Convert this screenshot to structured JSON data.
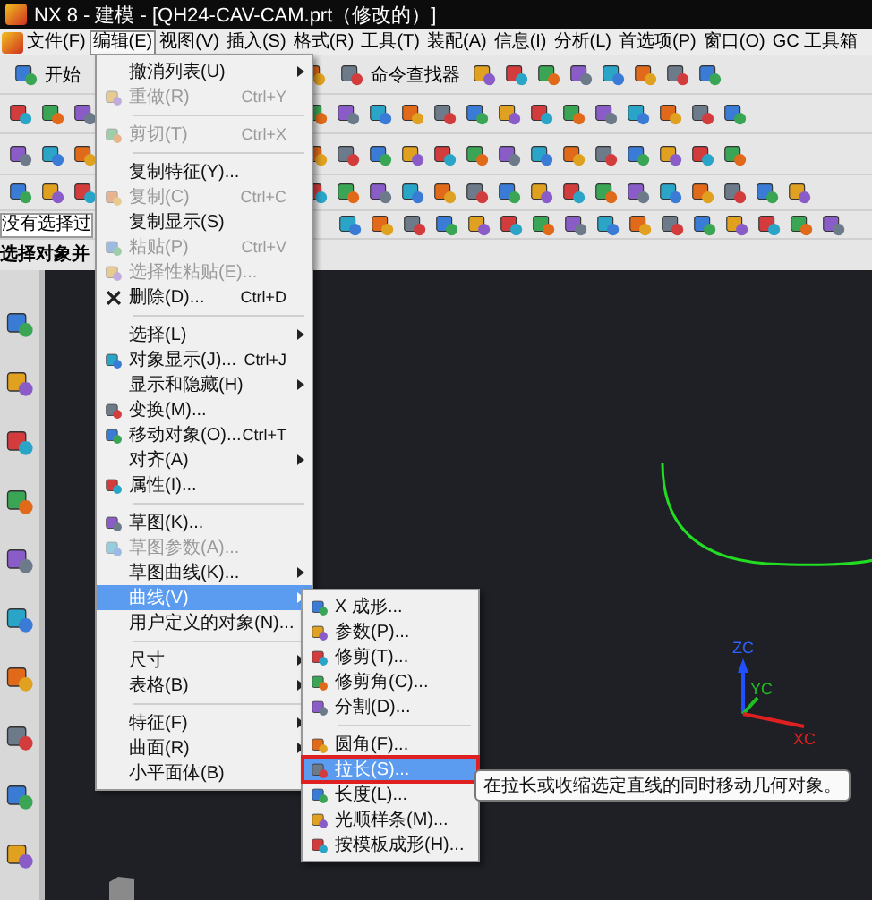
{
  "window": {
    "title": "NX 8 - 建模 - [QH24-CAV-CAM.prt（修改的）]"
  },
  "menu_bar": [
    {
      "label": "文件(F)",
      "selected": false
    },
    {
      "label": "编辑(E)",
      "selected": true
    },
    {
      "label": "视图(V)",
      "selected": false
    },
    {
      "label": "插入(S)",
      "selected": false
    },
    {
      "label": "格式(R)",
      "selected": false
    },
    {
      "label": "工具(T)",
      "selected": false
    },
    {
      "label": "装配(A)",
      "selected": false
    },
    {
      "label": "信息(I)",
      "selected": false
    },
    {
      "label": "分析(L)",
      "selected": false
    },
    {
      "label": "首选项(P)",
      "selected": false
    },
    {
      "label": "窗口(O)",
      "selected": false
    },
    {
      "label": "GC 工具箱",
      "selected": false
    }
  ],
  "toolbar": {
    "start_button": "开始",
    "command_finder": "命令查找器"
  },
  "selection_filter": {
    "value": "没有选择过"
  },
  "cue_line": "选择对象并",
  "edit_menu": {
    "items": [
      {
        "kind": "item",
        "label": "撤消列表(U)",
        "submenu": true,
        "disabled": false,
        "selected": false,
        "highlight_box": false
      },
      {
        "kind": "item",
        "label": "重做(R)",
        "shortcut": "Ctrl+Y",
        "submenu": false,
        "disabled": true,
        "selected": false,
        "highlight_box": false
      },
      {
        "kind": "separator"
      },
      {
        "kind": "item",
        "label": "剪切(T)",
        "shortcut": "Ctrl+X",
        "submenu": false,
        "disabled": true,
        "selected": false,
        "highlight_box": false
      },
      {
        "kind": "separator"
      },
      {
        "kind": "item",
        "label": "复制特征(Y)...",
        "submenu": false,
        "disabled": false,
        "selected": false,
        "highlight_box": false
      },
      {
        "kind": "item",
        "label": "复制(C)",
        "shortcut": "Ctrl+C",
        "submenu": false,
        "disabled": true,
        "selected": false,
        "highlight_box": false
      },
      {
        "kind": "item",
        "label": "复制显示(S)",
        "submenu": false,
        "disabled": false,
        "selected": false,
        "highlight_box": false
      },
      {
        "kind": "item",
        "label": "粘贴(P)",
        "shortcut": "Ctrl+V",
        "submenu": false,
        "disabled": true,
        "selected": false,
        "highlight_box": false
      },
      {
        "kind": "item",
        "label": "选择性粘贴(E)...",
        "submenu": false,
        "disabled": true,
        "selected": false,
        "highlight_box": false
      },
      {
        "kind": "item",
        "label": "删除(D)...",
        "shortcut": "Ctrl+D",
        "submenu": false,
        "disabled": false,
        "selected": false,
        "highlight_box": false
      },
      {
        "kind": "separator"
      },
      {
        "kind": "item",
        "label": "选择(L)",
        "submenu": true,
        "disabled": false,
        "selected": false,
        "highlight_box": false
      },
      {
        "kind": "item",
        "label": "对象显示(J)...",
        "shortcut": "Ctrl+J",
        "submenu": false,
        "disabled": false,
        "selected": false,
        "highlight_box": false
      },
      {
        "kind": "item",
        "label": "显示和隐藏(H)",
        "submenu": true,
        "disabled": false,
        "selected": false,
        "highlight_box": false
      },
      {
        "kind": "item",
        "label": "变换(M)...",
        "submenu": false,
        "disabled": false,
        "selected": false,
        "highlight_box": false
      },
      {
        "kind": "item",
        "label": "移动对象(O)...",
        "shortcut": "Ctrl+T",
        "submenu": false,
        "disabled": false,
        "selected": false,
        "highlight_box": false
      },
      {
        "kind": "item",
        "label": "对齐(A)",
        "submenu": true,
        "disabled": false,
        "selected": false,
        "highlight_box": false
      },
      {
        "kind": "item",
        "label": "属性(I)...",
        "submenu": false,
        "disabled": false,
        "selected": false,
        "highlight_box": false
      },
      {
        "kind": "separator"
      },
      {
        "kind": "item",
        "label": "草图(K)...",
        "submenu": false,
        "disabled": false,
        "selected": false,
        "highlight_box": false
      },
      {
        "kind": "item",
        "label": "草图参数(A)...",
        "submenu": false,
        "disabled": true,
        "selected": false,
        "highlight_box": false
      },
      {
        "kind": "item",
        "label": "草图曲线(K)...",
        "submenu": true,
        "disabled": false,
        "selected": false,
        "highlight_box": false
      },
      {
        "kind": "item",
        "label": "曲线(V)",
        "submenu": true,
        "disabled": false,
        "selected": true,
        "highlight_box": false
      },
      {
        "kind": "item",
        "label": "用户定义的对象(N)...",
        "submenu": false,
        "disabled": false,
        "selected": false,
        "highlight_box": false
      },
      {
        "kind": "separator"
      },
      {
        "kind": "item",
        "label": "尺寸",
        "submenu": true,
        "disabled": false,
        "selected": false,
        "highlight_box": false
      },
      {
        "kind": "item",
        "label": "表格(B)",
        "submenu": true,
        "disabled": false,
        "selected": false,
        "highlight_box": false
      },
      {
        "kind": "separator"
      },
      {
        "kind": "item",
        "label": "特征(F)",
        "submenu": true,
        "disabled": false,
        "selected": false,
        "highlight_box": false
      },
      {
        "kind": "item",
        "label": "曲面(R)",
        "submenu": true,
        "disabled": false,
        "selected": false,
        "highlight_box": false
      },
      {
        "kind": "item",
        "label": "小平面体(B)",
        "submenu": false,
        "disabled": false,
        "selected": false,
        "highlight_box": false
      }
    ]
  },
  "curve_submenu": {
    "items": [
      {
        "kind": "item",
        "label": "X 成形...",
        "submenu": false,
        "disabled": false,
        "selected": false,
        "highlight_box": false
      },
      {
        "kind": "item",
        "label": "参数(P)...",
        "submenu": false,
        "disabled": false,
        "selected": false,
        "highlight_box": false
      },
      {
        "kind": "item",
        "label": "修剪(T)...",
        "submenu": false,
        "disabled": false,
        "selected": false,
        "highlight_box": false
      },
      {
        "kind": "item",
        "label": "修剪角(C)...",
        "submenu": false,
        "disabled": false,
        "selected": false,
        "highlight_box": false
      },
      {
        "kind": "item",
        "label": "分割(D)...",
        "submenu": false,
        "disabled": false,
        "selected": false,
        "highlight_box": false
      },
      {
        "kind": "separator"
      },
      {
        "kind": "item",
        "label": "圆角(F)...",
        "submenu": false,
        "disabled": false,
        "selected": false,
        "highlight_box": false
      },
      {
        "kind": "item",
        "label": "拉长(S)...",
        "submenu": false,
        "disabled": false,
        "selected": true,
        "highlight_box": true
      },
      {
        "kind": "item",
        "label": "长度(L)...",
        "submenu": false,
        "disabled": false,
        "selected": false,
        "highlight_box": false
      },
      {
        "kind": "item",
        "label": "光顺样条(M)...",
        "submenu": false,
        "disabled": false,
        "selected": false,
        "highlight_box": false
      },
      {
        "kind": "item",
        "label": "按模板成形(H)...",
        "submenu": false,
        "disabled": false,
        "selected": false,
        "highlight_box": false
      }
    ]
  },
  "tooltip": "在拉长或收缩选定直线的同时移动几何对象。",
  "viewport": {
    "axis_labels": [
      "ZC",
      "YC",
      "XC"
    ]
  }
}
